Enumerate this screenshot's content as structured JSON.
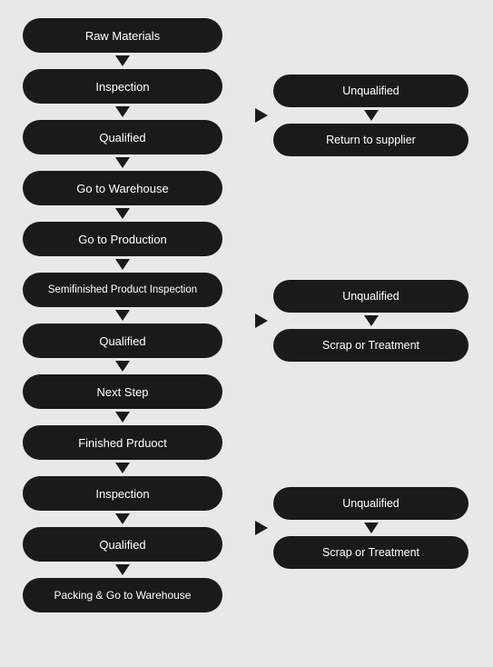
{
  "nodes": {
    "raw_materials": "Raw Materials",
    "inspection1": "Inspection",
    "qualified1": "Qualified",
    "go_to_warehouse": "Go to Warehouse",
    "go_to_production": "Go to Production",
    "semifinished_inspection": "Semifinished Product Inspection",
    "qualified2": "Qualified",
    "next_step": "Next Step",
    "finished_product": "Finished Prduoct",
    "inspection2": "Inspection",
    "qualified3": "Qualified",
    "packing": "Packing & Go to Warehouse",
    "unqualified1": "Unqualified",
    "return_supplier": "Return to supplier",
    "unqualified2": "Unqualified",
    "scrap_treatment1": "Scrap or Treatment",
    "unqualified3": "Unqualified",
    "scrap_treatment2": "Scrap or Treatment"
  }
}
